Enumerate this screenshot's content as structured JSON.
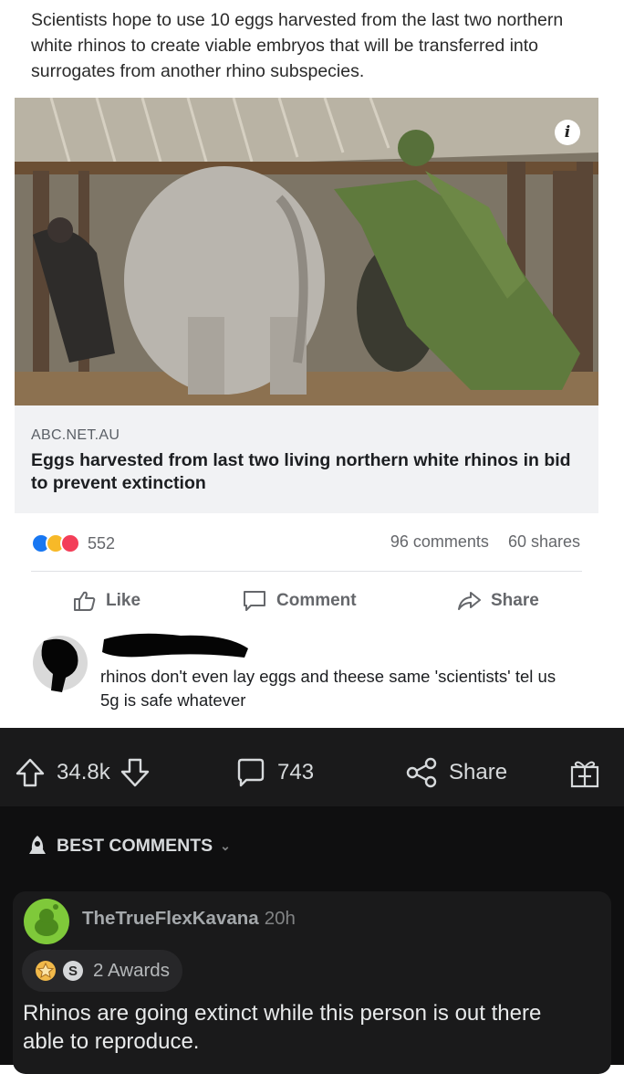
{
  "facebook_post": {
    "caption": "Scientists hope to use 10 eggs harvested from the last two northern white rhinos to create viable embryos that will be transferred into surrogates from another rhino subspecies.",
    "photo": {
      "info_icon": "info-icon"
    },
    "link": {
      "domain": "ABC.NET.AU",
      "title": "Eggs harvested from last two living northern white rhinos in bid to prevent extinction"
    },
    "reactions": {
      "icons": [
        "like-reaction-icon",
        "haha-reaction-icon",
        "love-reaction-icon"
      ],
      "count": "552"
    },
    "stats": {
      "comments": "96 comments",
      "shares": "60 shares"
    },
    "actions": {
      "like": "Like",
      "comment": "Comment",
      "share": "Share"
    },
    "comment": {
      "text": "rhinos don't even lay eggs and theese same 'scientists' tel us 5g is safe whatever"
    }
  },
  "reddit": {
    "bar": {
      "upvotes": "34.8k",
      "comments": "743",
      "share": "Share"
    },
    "sort_label": "BEST COMMENTS",
    "top_comment": {
      "username": "TheTrueFlexKavana",
      "age": "20h",
      "awards": "2 Awards",
      "body": "Rhinos are going extinct while this person is out there able to reproduce."
    },
    "colors": {
      "background": "#0f0f10",
      "card": "#1a1a1b",
      "text": "#d7dadc",
      "avatar": "#7fc93a"
    }
  }
}
